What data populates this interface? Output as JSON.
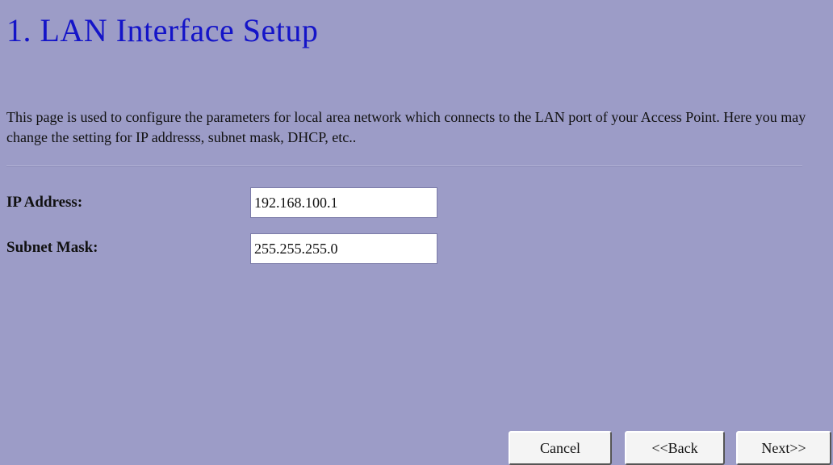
{
  "header": {
    "title": "1. LAN Interface Setup"
  },
  "description": "This page is used to configure the parameters for local area network which connects to the LAN port of your Access Point. Here you may change the setting for IP addresss, subnet mask, DHCP, etc..",
  "form": {
    "ip_address": {
      "label": "IP Address:",
      "value": "192.168.100.1"
    },
    "subnet_mask": {
      "label": "Subnet Mask:",
      "value": "255.255.255.0"
    }
  },
  "buttons": {
    "cancel": "Cancel",
    "back": "<<Back",
    "next": "Next>>"
  },
  "colors": {
    "background": "#9c9cc7",
    "title": "#1414c8"
  }
}
